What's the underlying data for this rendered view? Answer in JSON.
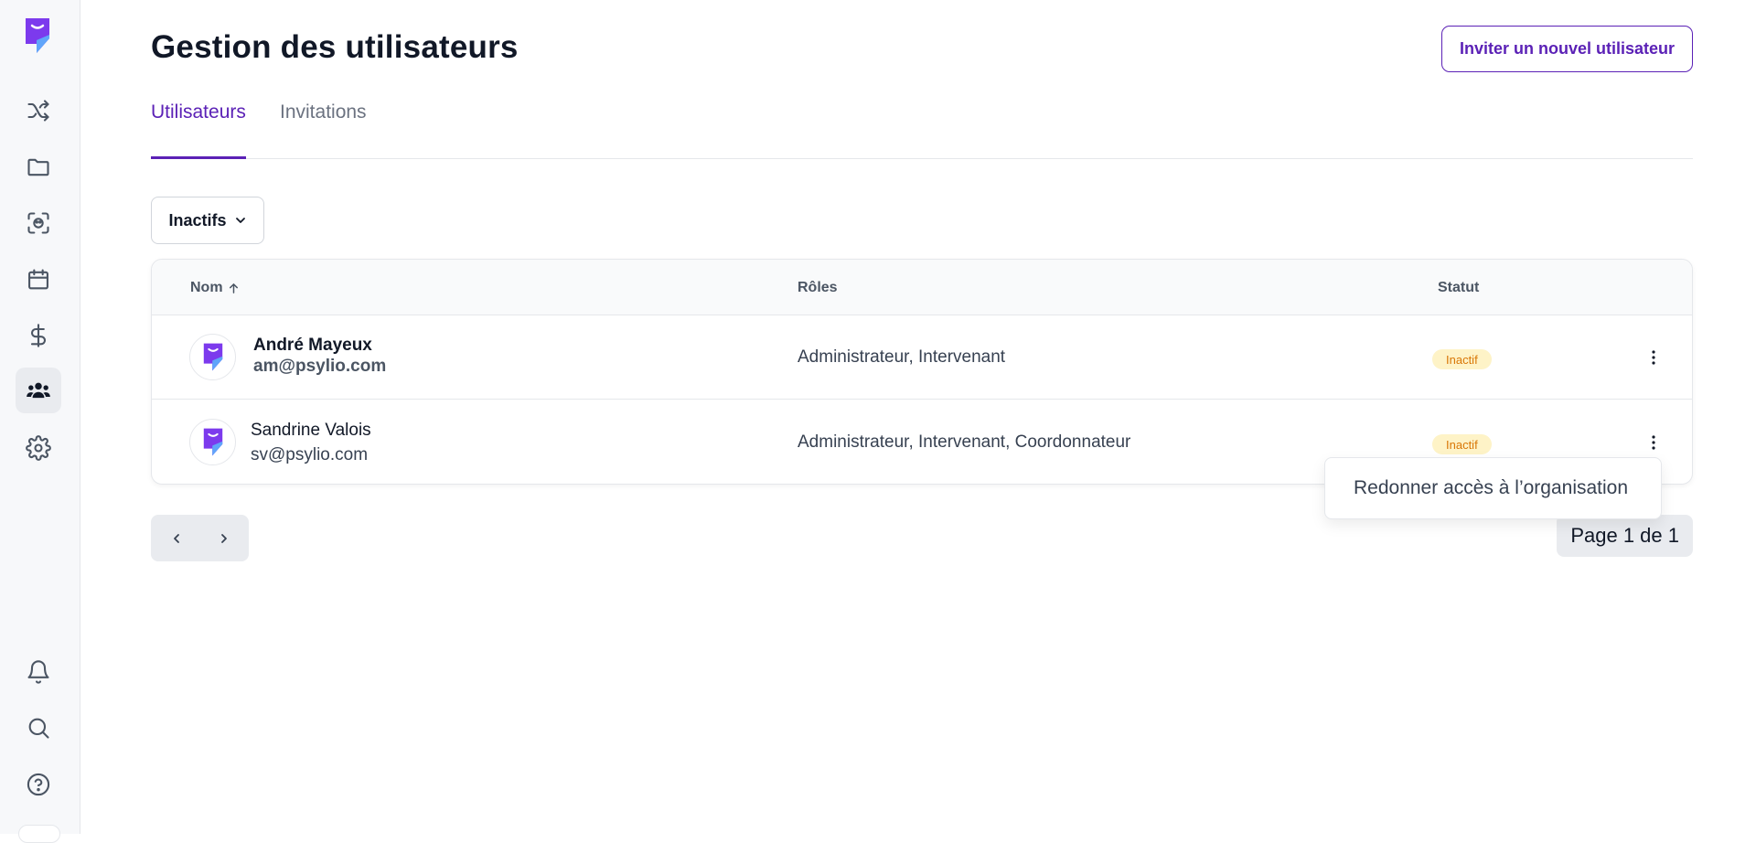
{
  "page": {
    "title": "Gestion des utilisateurs",
    "invite_label": "Inviter un nouvel utilisateur"
  },
  "tabs": [
    {
      "label": "Utilisateurs",
      "active": true
    },
    {
      "label": "Invitations",
      "active": false
    }
  ],
  "filter": {
    "selected": "Inactifs"
  },
  "table": {
    "columns": {
      "name": "Nom",
      "roles": "Rôles",
      "status": "Statut"
    },
    "sort": {
      "column": "Nom",
      "direction": "ascending"
    },
    "rows": [
      {
        "name": "André Mayeux",
        "email": "am@psylio.com",
        "roles": "Administrateur, Intervenant",
        "status": "Inactif"
      },
      {
        "name": "Sandrine Valois",
        "email": "sv@psylio.com",
        "roles": "Administrateur, Intervenant, Coordonnateur",
        "status": "Inactif"
      }
    ]
  },
  "row_menu": {
    "item": "Redonner accès à l’organisation"
  },
  "pagination": {
    "label": "Page 1 de 1"
  },
  "sidebar": {
    "items": [
      {
        "icon": "shuffle-icon"
      },
      {
        "icon": "folder-icon"
      },
      {
        "icon": "face-scan-icon"
      },
      {
        "icon": "calendar-icon"
      },
      {
        "icon": "dollar-icon"
      },
      {
        "icon": "users-icon",
        "active": true
      },
      {
        "icon": "gear-icon"
      }
    ],
    "bottom_items": [
      {
        "icon": "bell-icon"
      },
      {
        "icon": "search-icon"
      },
      {
        "icon": "help-icon"
      }
    ]
  },
  "colors": {
    "accent": "#5b21b6",
    "logo_primary": "#7c3aed",
    "logo_secondary": "#60a5fa",
    "badge_bg": "#fef3c7",
    "badge_text": "#d97706"
  }
}
